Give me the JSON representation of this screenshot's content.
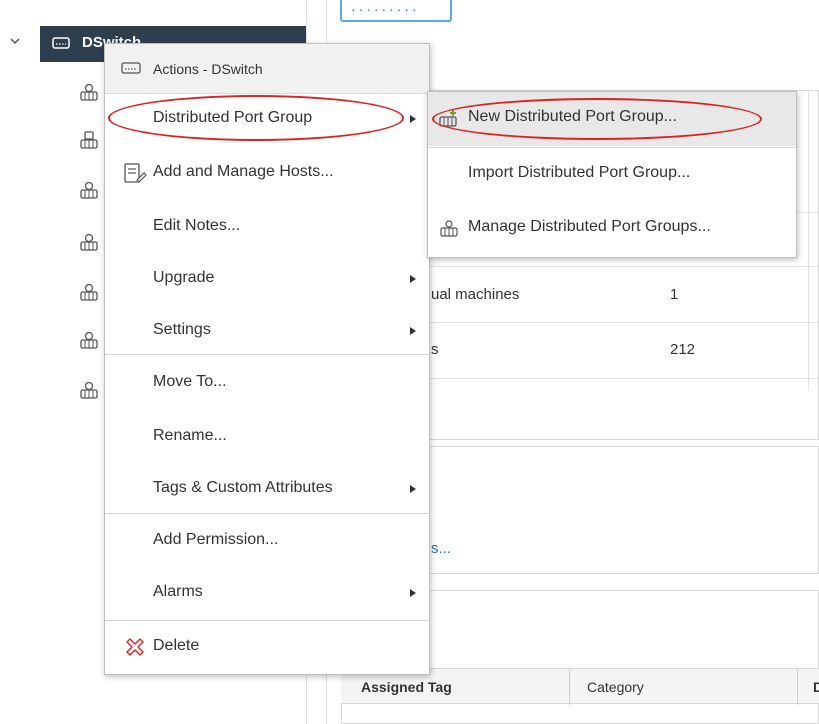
{
  "tree": {
    "selected_label": "DSwitch",
    "selected_icon": "switch-icon",
    "child_icon": "port-group-icon",
    "child_count": 7
  },
  "background": {
    "rows": [
      {
        "label": "ual machines",
        "value": "1"
      },
      {
        "label": "s",
        "value": "212"
      }
    ],
    "link_text": "s...",
    "table_headers": [
      "Assigned Tag",
      "Category",
      "D"
    ]
  },
  "context_menu": {
    "header": "Actions - DSwitch",
    "items": [
      {
        "label": "Distributed Port Group",
        "has_submenu": true
      },
      {
        "label": "Add and Manage Hosts...",
        "icon": "add-hosts-icon"
      },
      {
        "label": "Edit Notes..."
      },
      {
        "label": "Upgrade",
        "has_submenu": true
      },
      {
        "label": "Settings",
        "has_submenu": true
      },
      {
        "label": "Move To..."
      },
      {
        "label": "Rename..."
      },
      {
        "label": "Tags & Custom Attributes",
        "has_submenu": true
      },
      {
        "label": "Add Permission..."
      },
      {
        "label": "Alarms",
        "has_submenu": true
      },
      {
        "label": "Delete",
        "icon": "delete-icon"
      }
    ]
  },
  "submenu": {
    "items": [
      {
        "label": "New Distributed Port Group...",
        "icon": "new-port-group-icon",
        "highlighted": true
      },
      {
        "label": "Import Distributed Port Group..."
      },
      {
        "label": "Manage Distributed Port Groups...",
        "icon": "manage-port-groups-icon"
      }
    ]
  },
  "colors": {
    "selected_bg": "#2f3e4e",
    "annotation": "#e02020",
    "delete_icon": "#e02020"
  }
}
